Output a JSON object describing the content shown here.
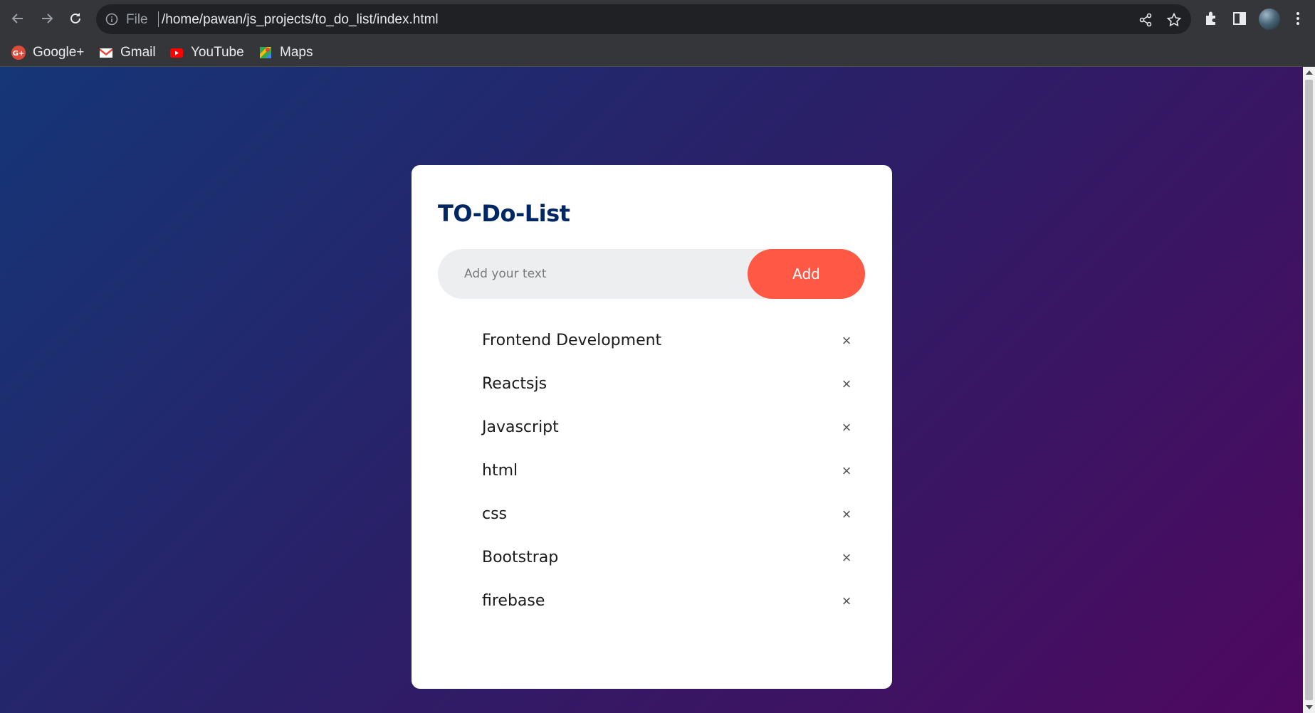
{
  "browser": {
    "url_scheme": "File",
    "url": "/home/pawan/js_projects/to_do_list/index.html",
    "bookmarks": [
      {
        "label": "Google+",
        "icon": "google-plus-icon"
      },
      {
        "label": "Gmail",
        "icon": "gmail-icon"
      },
      {
        "label": "YouTube",
        "icon": "youtube-icon"
      },
      {
        "label": "Maps",
        "icon": "maps-icon"
      }
    ]
  },
  "app": {
    "title": "TO-Do-List",
    "input_placeholder": "Add your text",
    "add_label": "Add",
    "delete_glyph": "×",
    "items": [
      {
        "text": "Frontend Development"
      },
      {
        "text": "Reactsjs"
      },
      {
        "text": "Javascript"
      },
      {
        "text": "html"
      },
      {
        "text": "css"
      },
      {
        "text": "Bootstrap"
      },
      {
        "text": "firebase"
      }
    ]
  },
  "colors": {
    "accent": "#ff5945",
    "title": "#002765",
    "bg_start": "#153677",
    "bg_end": "#4e085f"
  }
}
